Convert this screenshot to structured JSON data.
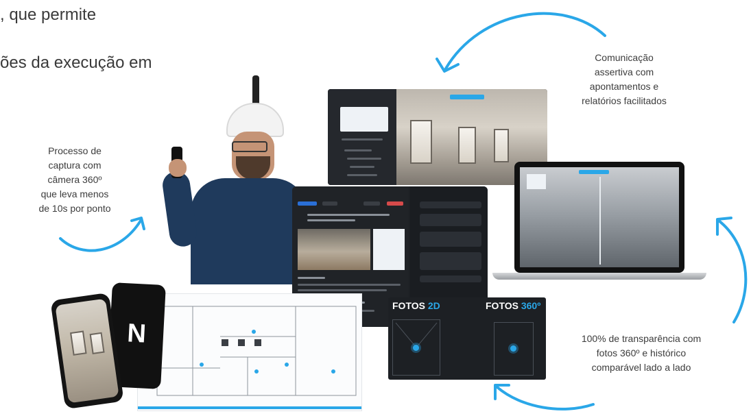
{
  "headline": {
    "line1": ", que permite",
    "line2": "ões da execução em"
  },
  "captions": {
    "capture": [
      "Processo de",
      "captura com",
      "câmera 360º",
      "que leva menos",
      "de 10s por ponto"
    ],
    "communication": [
      "Comunicação",
      "assertiva com",
      "apontamentos e",
      "relatórios facilitados"
    ],
    "transparency": [
      "100% de transparência com",
      "fotos 360º e histórico",
      "comparável lado a lado"
    ]
  },
  "fotos_panel": {
    "left_prefix": "FOTOS ",
    "left_accent": "2D",
    "right_prefix": "FOTOS ",
    "right_accent": "360º"
  },
  "app_logo": "N",
  "colors": {
    "arrow": "#2aa7e8",
    "accent": "#2aa7e8",
    "dark_panel": "#1d2024",
    "text": "#3c3c3c"
  }
}
